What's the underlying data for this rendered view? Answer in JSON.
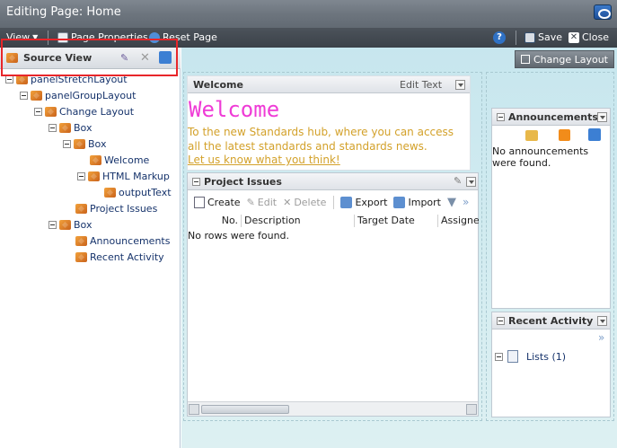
{
  "window": {
    "title": "Editing Page: Home"
  },
  "toolbar": {
    "view": "View",
    "page_properties": "Page Properties",
    "reset_page": "Reset Page",
    "save": "Save",
    "close": "Close"
  },
  "source_view": {
    "title": "Source View",
    "tree": [
      {
        "label": "panelStretchLayout"
      },
      {
        "label": "panelGroupLayout"
      },
      {
        "label": "Change Layout"
      },
      {
        "label": "Box"
      },
      {
        "label": "Box"
      },
      {
        "label": "Welcome"
      },
      {
        "label": "HTML Markup"
      },
      {
        "label": "outputText"
      },
      {
        "label": "Project Issues"
      },
      {
        "label": "Box"
      },
      {
        "label": "Announcements"
      },
      {
        "label": "Recent Activity"
      }
    ]
  },
  "change_layout": "Change Layout",
  "welcome_box": {
    "title": "Welcome",
    "edit_text": "Edit Text",
    "heading": "Welcome",
    "body": "To the new Standards hub, where you can access all the latest standards and standards news.",
    "link": "Let us know what you think!"
  },
  "project_issues": {
    "title": "Project Issues",
    "buttons": {
      "create": "Create",
      "edit": "Edit",
      "delete": "Delete",
      "export": "Export",
      "import": "Import"
    },
    "columns": [
      "No.",
      "Description",
      "Target Date",
      "Assigned"
    ],
    "empty": "No rows were found."
  },
  "announcements": {
    "title": "Announcements",
    "empty": "No announcements were found."
  },
  "recent_activity": {
    "title": "Recent Activity",
    "item": "Lists (1)"
  },
  "colors": {
    "highlight_frame": "#e8262a",
    "welcome_heading": "#ef3bd6",
    "welcome_text": "#d3a12a",
    "tree_text": "#16336b"
  }
}
